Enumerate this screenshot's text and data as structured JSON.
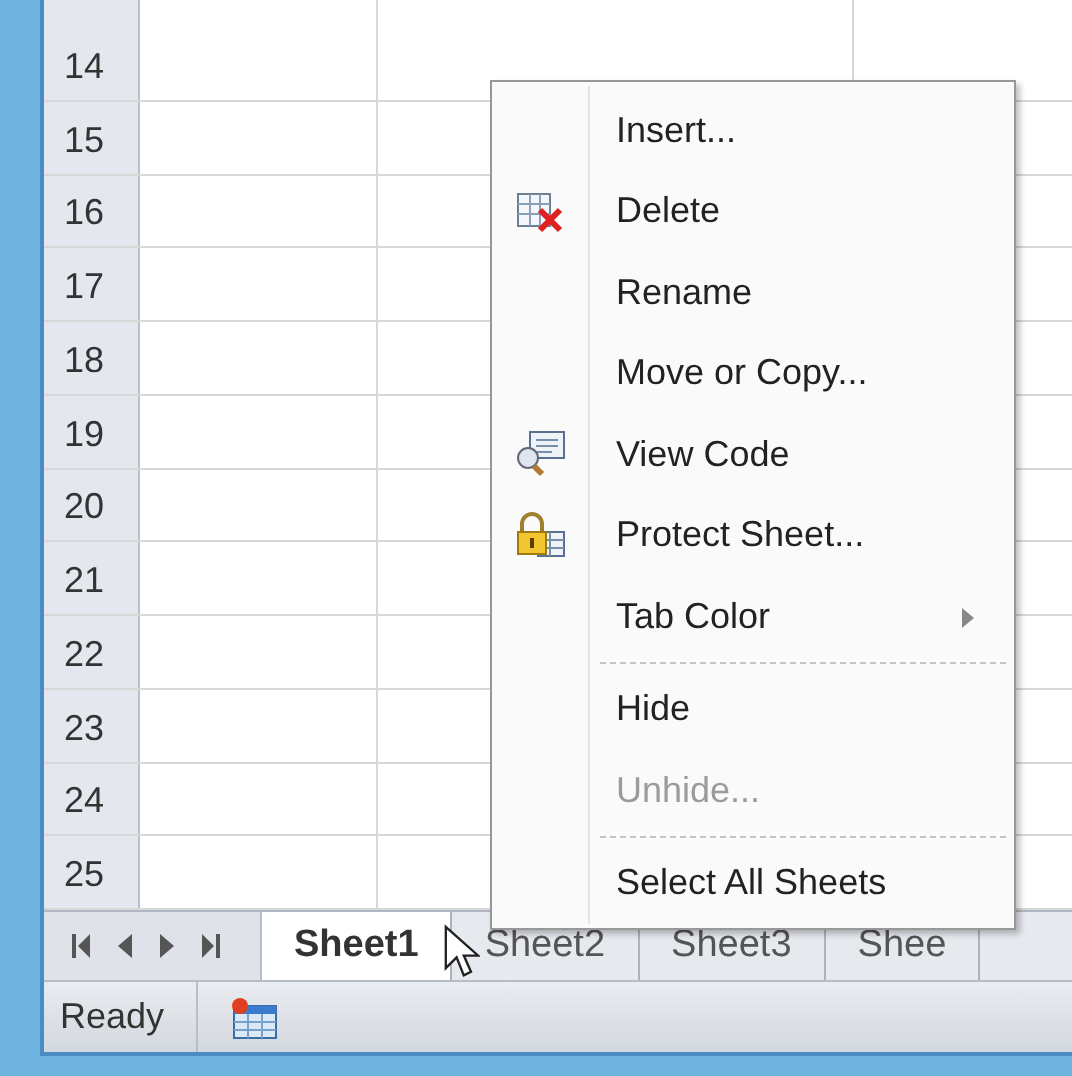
{
  "rows": [
    "14",
    "15",
    "16",
    "17",
    "18",
    "19",
    "20",
    "21",
    "22",
    "23",
    "24",
    "25"
  ],
  "sheet_tabs": [
    {
      "label": "Sheet1",
      "selected": true
    },
    {
      "label": "Sheet2",
      "selected": false
    },
    {
      "label": "Sheet3",
      "selected": false
    },
    {
      "label": "Shee",
      "selected": false
    }
  ],
  "status_bar": {
    "text": "Ready"
  },
  "context_menu": [
    {
      "label": "Insert...",
      "kind": "plain",
      "disabled": false,
      "submenu": false,
      "separator_before": false
    },
    {
      "label": "Delete",
      "kind": "delete",
      "disabled": false,
      "submenu": false,
      "separator_before": false
    },
    {
      "label": "Rename",
      "kind": "plain",
      "disabled": false,
      "submenu": false,
      "separator_before": false
    },
    {
      "label": "Move or Copy...",
      "kind": "plain",
      "disabled": false,
      "submenu": false,
      "separator_before": false
    },
    {
      "label": "View Code",
      "kind": "code",
      "disabled": false,
      "submenu": false,
      "separator_before": false
    },
    {
      "label": "Protect Sheet...",
      "kind": "lock",
      "disabled": false,
      "submenu": false,
      "separator_before": false
    },
    {
      "label": "Tab Color",
      "kind": "plain",
      "disabled": false,
      "submenu": true,
      "separator_before": false
    },
    {
      "label": "Hide",
      "kind": "plain",
      "disabled": false,
      "submenu": false,
      "separator_before": true
    },
    {
      "label": "Unhide...",
      "kind": "plain",
      "disabled": true,
      "submenu": false,
      "separator_before": false
    },
    {
      "label": "Select All Sheets",
      "kind": "plain",
      "disabled": false,
      "submenu": false,
      "separator_before": true
    }
  ]
}
